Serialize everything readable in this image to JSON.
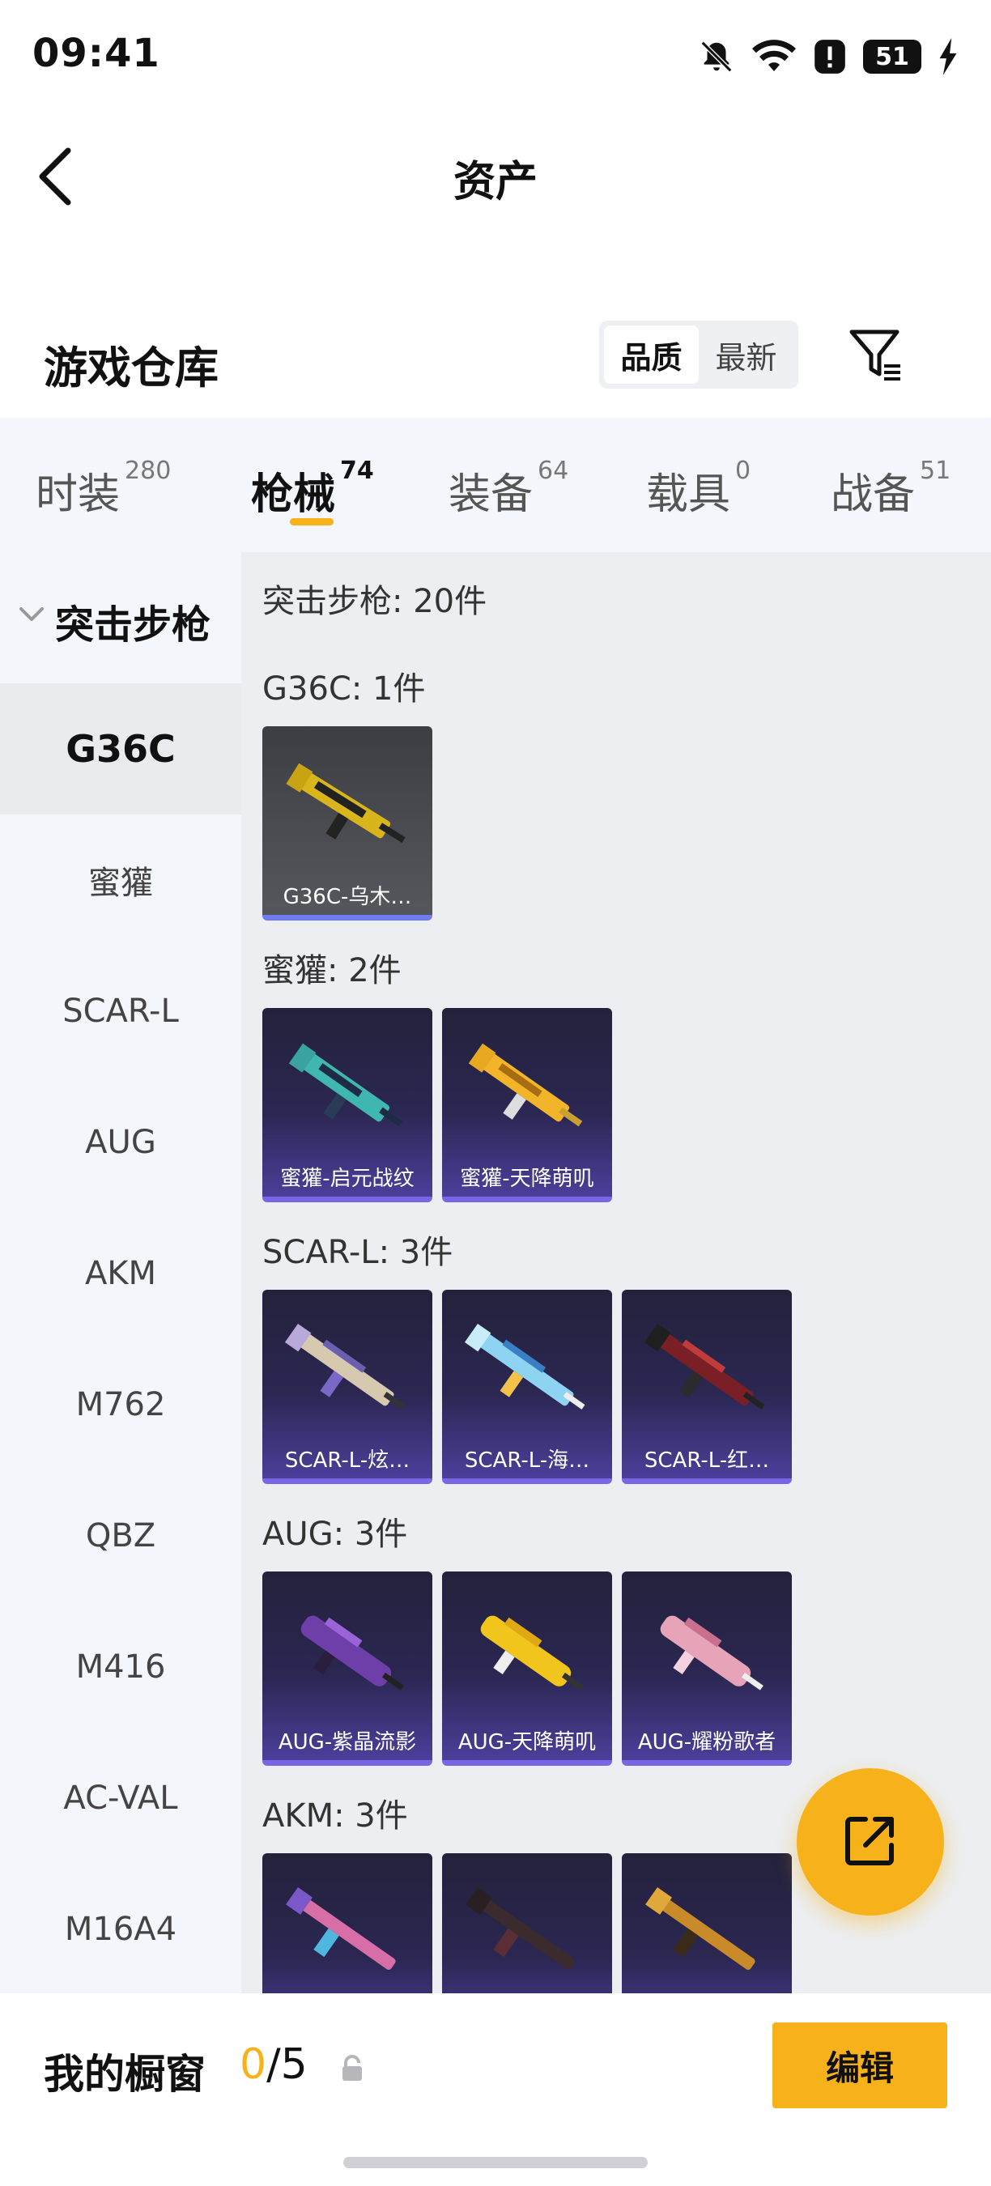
{
  "status_bar": {
    "time": "09:41",
    "battery": "51"
  },
  "header": {
    "title": "资产"
  },
  "warehouse": {
    "title": "游戏仓库",
    "sort_options": [
      "品质",
      "最新"
    ],
    "active_sort": "品质"
  },
  "tabs": [
    {
      "label": "时装",
      "count": "280"
    },
    {
      "label": "枪械",
      "count": "74"
    },
    {
      "label": "装备",
      "count": "64"
    },
    {
      "label": "载具",
      "count": "0"
    },
    {
      "label": "战备",
      "count": "51"
    }
  ],
  "active_tab": "枪械",
  "sidebar": {
    "group_label": "突击步枪",
    "items": [
      "G36C",
      "蜜獾",
      "SCAR-L",
      "AUG",
      "AKM",
      "M762",
      "QBZ",
      "M416",
      "AC-VAL",
      "M16A4"
    ],
    "active_item": "G36C"
  },
  "content": {
    "summary": "突击步枪: 20件",
    "groups": [
      {
        "title": "G36C: 1件",
        "items": [
          "G36C-乌木…"
        ]
      },
      {
        "title": "蜜獾: 2件",
        "items": [
          "蜜獾-启元战纹",
          "蜜獾-天降萌叽"
        ]
      },
      {
        "title": "SCAR-L: 3件",
        "items": [
          "SCAR-L-炫…",
          "SCAR-L-海…",
          "SCAR-L-红…"
        ]
      },
      {
        "title": "AUG: 3件",
        "items": [
          "AUG-紫晶流影",
          "AUG-天降萌叽",
          "AUG-耀粉歌者"
        ]
      },
      {
        "title": "AKM: 3件",
        "items": [
          "",
          "",
          ""
        ]
      }
    ]
  },
  "bottom_bar": {
    "showcase_label": "我的橱窗",
    "showcase_current": "0",
    "showcase_total": "/5",
    "edit_label": "编辑"
  },
  "colors": {
    "accent": "#f7b21b",
    "card_border": "#7867e4"
  },
  "icons": [
    "bell-off-icon",
    "wifi-icon",
    "alert-icon",
    "battery-icon",
    "charging-icon",
    "back-arrow-icon",
    "filter-icon",
    "chevron-down-icon",
    "share-icon",
    "lock-icon"
  ]
}
